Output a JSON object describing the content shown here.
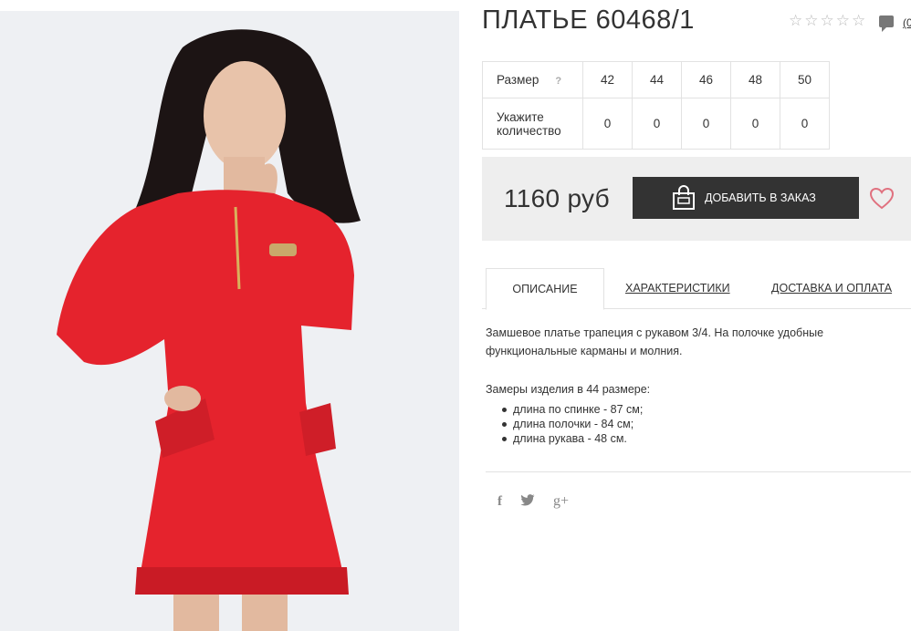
{
  "product": {
    "title": "ПЛАТЬЕ 60468/1",
    "photo_icon": "product-photo-red-dress",
    "rating_stars": 0,
    "rating_max": 5,
    "comment_count": "(0"
  },
  "sizes": {
    "size_label": "Размер",
    "help": "?",
    "qty_label_1": "Укажите",
    "qty_label_2": "количество",
    "items": [
      {
        "size": "42",
        "qty": "0"
      },
      {
        "size": "44",
        "qty": "0"
      },
      {
        "size": "46",
        "qty": "0"
      },
      {
        "size": "48",
        "qty": "0"
      },
      {
        "size": "50",
        "qty": "0"
      }
    ]
  },
  "purchase": {
    "price": "1160 руб",
    "add_button": "ДОБАВИТЬ В ЗАКАЗ",
    "bag_icon": "shopping-bag-icon",
    "wishlist_icon": "heart-icon",
    "accent_color": "#e0717f",
    "button_color": "#333333"
  },
  "tabs": [
    {
      "label": "ОПИСАНИЕ",
      "active": true
    },
    {
      "label": "ХАРАКТЕРИСТИКИ",
      "active": false
    },
    {
      "label": "ДОСТАВКА И ОПЛАТА",
      "active": false
    }
  ],
  "description": {
    "text": "Замшевое платье трапеция с рукавом 3/4. На полочке удобные функциональные карманы и молния.",
    "measures_title": "Замеры изделия в 44 размере:",
    "measures": [
      "длина по спинке - 87 см;",
      "длина полочки - 84 см;",
      "длина рукава - 48 см."
    ]
  },
  "social": {
    "facebook": "f",
    "twitter": "t",
    "googleplus": "g+"
  }
}
